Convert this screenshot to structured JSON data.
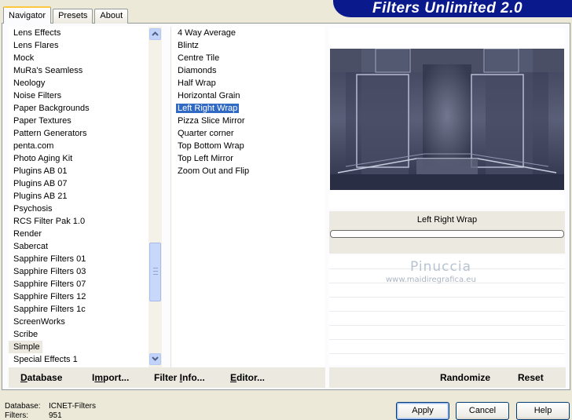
{
  "header": {
    "title": "Filters Unlimited 2.0"
  },
  "tabs": [
    {
      "label": "Navigator",
      "active": true
    },
    {
      "label": "Presets",
      "active": false
    },
    {
      "label": "About",
      "active": false
    }
  ],
  "categories": [
    "Lens Effects",
    "Lens Flares",
    "Mock",
    "MuRa's Seamless",
    "Neology",
    "Noise Filters",
    "Paper Backgrounds",
    "Paper Textures",
    "Pattern Generators",
    "penta.com",
    "Photo Aging Kit",
    "Plugins AB 01",
    "Plugins AB 07",
    "Plugins AB 21",
    "Psychosis",
    "RCS Filter Pak 1.0",
    "Render",
    "Sabercat",
    "Sapphire Filters 01",
    "Sapphire Filters 03",
    "Sapphire Filters 07",
    "Sapphire Filters 12",
    "Sapphire Filters 1c",
    "ScreenWorks",
    "Scribe",
    "Simple",
    "Special Effects 1"
  ],
  "selected_category": "Simple",
  "filters": [
    "4 Way Average",
    "Blintz",
    "Centre Tile",
    "Diamonds",
    "Half Wrap",
    "Horizontal Grain",
    "Left Right Wrap",
    "Pizza Slice Mirror",
    "Quarter corner",
    "Top Bottom Wrap",
    "Top Left Mirror",
    "Zoom Out and Flip"
  ],
  "selected_filter": "Left Right Wrap",
  "preview": {
    "filter_name": "Left Right Wrap"
  },
  "watermark": {
    "line1": "Pinuccia",
    "line2": "www.maidiregrafica.eu"
  },
  "bottom_buttons": {
    "database": {
      "u": "D",
      "rest": "atabase"
    },
    "import": {
      "pre": "I",
      "u": "m",
      "rest": "port..."
    },
    "filter_info": {
      "pre": "Filter ",
      "u": "I",
      "rest": "nfo..."
    },
    "editor": {
      "u": "E",
      "rest": "ditor..."
    },
    "randomize": "Randomize",
    "reset": "Reset"
  },
  "status": {
    "database_label": "Database:",
    "database_value": "ICNET-Filters",
    "filters_label": "Filters:",
    "filters_value": "951"
  },
  "dialog_buttons": {
    "apply": "Apply",
    "cancel": "Cancel",
    "help": "Help"
  },
  "colors": {
    "banner": "#0a1a8c",
    "selection": "#316ac5",
    "active_tab_accent": "#ffc83c"
  }
}
